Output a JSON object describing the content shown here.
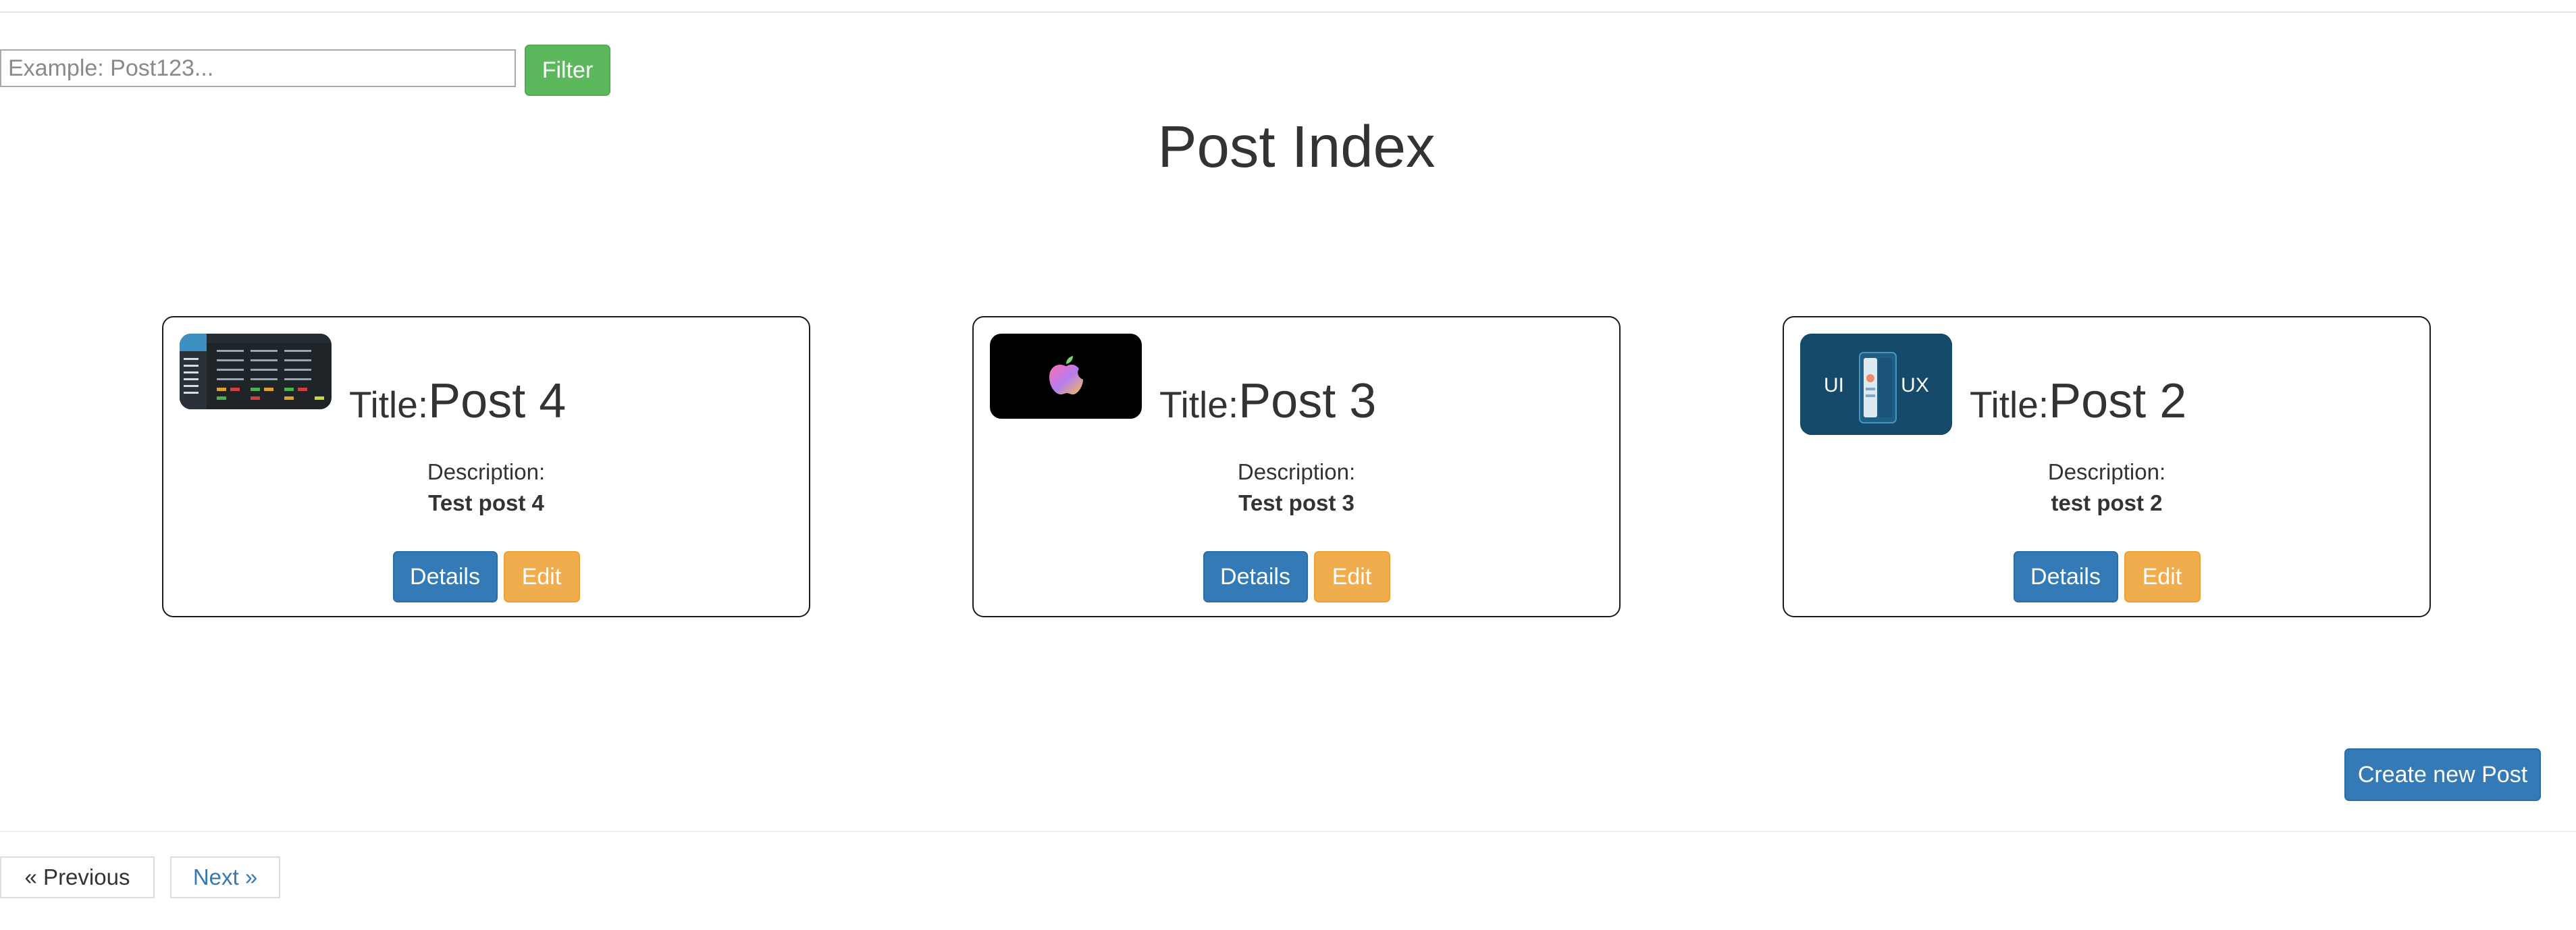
{
  "filter": {
    "input_value": "",
    "placeholder": "Example: Post123...",
    "button_label": "Filter"
  },
  "page": {
    "title": "Post Index"
  },
  "posts": [
    {
      "title_prefix": "Title:",
      "title": "Post 4",
      "description_label": "Description:",
      "description": "Test post 4",
      "details_label": "Details",
      "edit_label": "Edit",
      "thumbnail": "dashboard-screenshot-image"
    },
    {
      "title_prefix": "Title:",
      "title": "Post 3",
      "description_label": "Description:",
      "description": "Test post 3",
      "details_label": "Details",
      "edit_label": "Edit",
      "thumbnail": "apple-logo-image"
    },
    {
      "title_prefix": "Title:",
      "title": "Post 2",
      "description_label": "Description:",
      "description": "test post 2",
      "details_label": "Details",
      "edit_label": "Edit",
      "thumbnail": "ui-ux-phone-image",
      "thumbnail_text_left": "UI",
      "thumbnail_text_right": "UX"
    }
  ],
  "create_button_label": "Create new Post",
  "pagination": {
    "previous_label": "« Previous",
    "next_label": "Next »"
  },
  "colors": {
    "filter_green": "#5cb85c",
    "primary_blue": "#337ab7",
    "warning_orange": "#f0ad4e",
    "text": "#333333"
  }
}
